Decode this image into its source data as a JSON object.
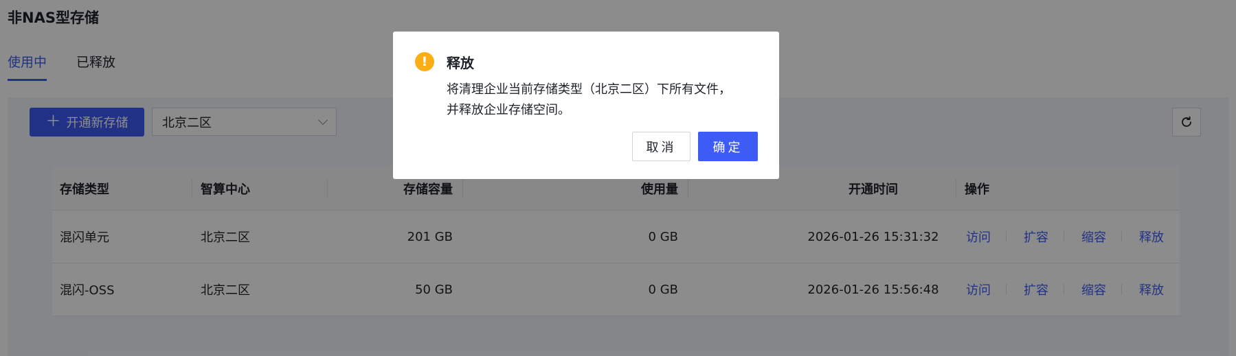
{
  "page": {
    "title": "非NAS型存储"
  },
  "tabs": [
    {
      "label": "使用中",
      "active": true
    },
    {
      "label": "已释放",
      "active": false
    }
  ],
  "toolbar": {
    "create_label": "开通新存储",
    "region_value": "北京二区",
    "refresh_icon": "refresh-icon"
  },
  "table": {
    "headers": [
      "存储类型",
      "智算中心",
      "存储容量",
      "使用量",
      "开通时间",
      "操作"
    ],
    "rows": [
      {
        "type": "混闪单元",
        "center": "北京二区",
        "capacity": "201 GB",
        "used": "0 GB",
        "time": "2026-01-26 15:31:32"
      },
      {
        "type": "混闪-OSS",
        "center": "北京二区",
        "capacity": "50 GB",
        "used": "0 GB",
        "time": "2026-01-26 15:56:48"
      }
    ],
    "actions": [
      "访问",
      "扩容",
      "缩容",
      "释放"
    ]
  },
  "dialog": {
    "title": "释放",
    "icon": "warning-icon",
    "message_line1": "将清理企业当前存储类型（北京二区）下所有文件，",
    "message_line2": "并释放企业存储空间。",
    "cancel_label": "取消",
    "ok_label": "确定"
  },
  "colors": {
    "primary": "#3d5bf5",
    "warning": "#faad14"
  }
}
